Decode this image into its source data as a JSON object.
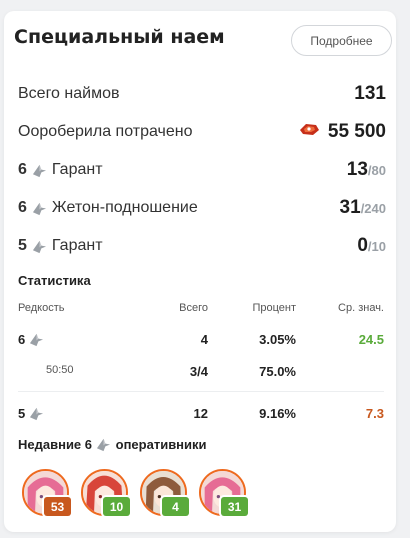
{
  "title": "Специальный наем",
  "more_button": "Подробнее",
  "summary": {
    "total": {
      "label": "Всего наймов",
      "value": "131"
    },
    "spent": {
      "label": "Оороберила потрачено",
      "value": "55 500",
      "icon": "orundum-icon"
    },
    "g6_guarantee": {
      "rarity": "6",
      "label": "Гарант",
      "value": "13",
      "den": "/80"
    },
    "g6_token": {
      "rarity": "6",
      "label": "Жетон-подношение",
      "value": "31",
      "den": "/240"
    },
    "g5_guarantee": {
      "rarity": "5",
      "label": "Гарант",
      "value": "0",
      "den": "/10"
    }
  },
  "stats": {
    "title": "Статистика",
    "headers": [
      "Редкость",
      "Всего",
      "Процент",
      "Ср. знач."
    ],
    "rows": [
      {
        "rarity": "6",
        "total": "4",
        "percent": "3.05%",
        "avg": "24.5",
        "avg_color": "#5aab3b"
      },
      {
        "rarity_sub": "50:50",
        "total": "3/4",
        "percent": "75.0%",
        "avg": ""
      },
      {
        "rarity": "5",
        "total": "12",
        "percent": "9.16%",
        "avg": "7.3",
        "avg_color": "#c8581e"
      }
    ]
  },
  "recent": {
    "title_prefix": "Недавние 6",
    "title_suffix": "оперативники",
    "operators": [
      {
        "count": "53",
        "badge_color": "#c8581e",
        "hair": "#e66c95"
      },
      {
        "count": "10",
        "badge_color": "#5aab3b",
        "hair": "#d8453a"
      },
      {
        "count": "4",
        "badge_color": "#5aab3b",
        "hair": "#8e5b3c"
      },
      {
        "count": "31",
        "badge_color": "#5aab3b",
        "hair": "#e66c95"
      }
    ]
  },
  "colors": {
    "accent_orange": "#ee6a1f",
    "green": "#5aab3b",
    "orange": "#c8581e"
  }
}
